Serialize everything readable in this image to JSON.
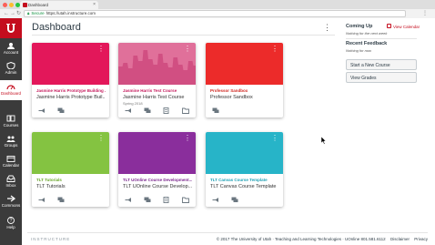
{
  "browser": {
    "tab_title": "Dashboard",
    "secure_label": "Secure",
    "url": "https://utah.instructure.com"
  },
  "global_nav": {
    "items": [
      {
        "label": "Account",
        "icon": "account-icon"
      },
      {
        "label": "Admin",
        "icon": "admin-icon"
      },
      {
        "label": "Dashboard",
        "icon": "dashboard-icon"
      },
      {
        "label": "Courses",
        "icon": "courses-icon"
      },
      {
        "label": "Groups",
        "icon": "groups-icon"
      },
      {
        "label": "Calendar",
        "icon": "calendar-icon"
      },
      {
        "label": "Inbox",
        "icon": "inbox-icon"
      },
      {
        "label": "Commons",
        "icon": "commons-icon"
      },
      {
        "label": "Help",
        "icon": "help-icon"
      }
    ],
    "active": "Dashboard",
    "brand_color": "#c40d1e"
  },
  "header": {
    "title": "Dashboard"
  },
  "cards": [
    {
      "short": "Jasmine Harris Prototype Building ...",
      "long": "Jasmine Harris Prototype Buil...",
      "term": "",
      "color": "#e3175a",
      "short_color": "#c51a5c"
    },
    {
      "short": "Jasmine Harris Test Course",
      "long": "Jasmine Harris Test Course",
      "term": "Spring 2018",
      "color": "#e0709a",
      "short_color": "#c51a5c"
    },
    {
      "short": "Professor Sandbox",
      "long": "Professor Sandbox",
      "term": "",
      "color": "#ec2b2a",
      "short_color": "#d0261f"
    },
    {
      "short": "TLT Tutorials",
      "long": "TLT Tutorials",
      "term": "",
      "color": "#84c341",
      "short_color": "#6aa52a"
    },
    {
      "short": "TLT UOnline Course Development...",
      "long": "TLT UOnline Course Develop...",
      "term": "",
      "color": "#8a2e9c",
      "short_color": "#7b278d"
    },
    {
      "short": "TLT Canvas Course Template",
      "long": "TLT Canvas Course Template",
      "term": "",
      "color": "#27b4c8",
      "short_color": "#1fa0b4"
    }
  ],
  "sidebar": {
    "coming_up": "Coming Up",
    "view_calendar": "View Calendar",
    "coming_up_empty": "Nothing for the next week",
    "recent_feedback": "Recent Feedback",
    "recent_feedback_empty": "Nothing for now",
    "start_new_course": "Start a New Course",
    "view_grades": "View Grades"
  },
  "footer": {
    "logo": "INSTRUCTURE",
    "copyright": "© 2017  The University of Utah · Teaching and Learning Technologies · UOnline  801.581.6112",
    "disclaimer": "Disclaimer",
    "privacy": "Privacy"
  }
}
